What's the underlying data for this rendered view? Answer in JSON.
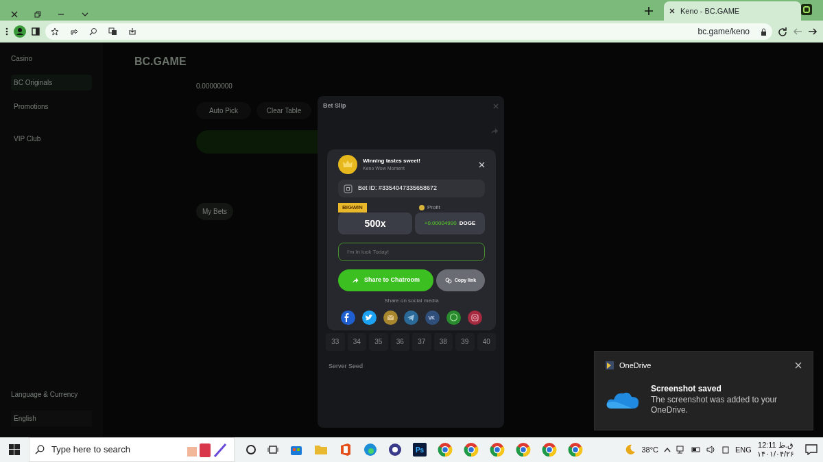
{
  "browser": {
    "tab_title": "Keno - BC.GAME",
    "url": "bc.game/keno"
  },
  "page": {
    "top_nav": "Casino",
    "logo": "BC.GAME",
    "sidebar": [
      {
        "label": "BC Originals",
        "selected": true
      },
      {
        "label": "Promotions",
        "selected": false
      },
      {
        "label": "VIP Club",
        "selected": false
      }
    ],
    "language_label": "Language & Currency",
    "language": "English",
    "bet_amount": "0.00000000",
    "buttons": [
      "Auto Pick",
      "Clear Table"
    ],
    "bet_tabs": [
      {
        "label": "My Bets",
        "selected": true
      }
    ]
  },
  "bet_slip": {
    "title": "Bet Slip",
    "numbers": [
      "33",
      "34",
      "35",
      "36",
      "37",
      "38",
      "39",
      "40"
    ],
    "section": "Server Seed"
  },
  "share": {
    "title": "Winning tastes sweet!",
    "subtitle": "Keno Wow Moment",
    "bet_id": "Bet ID: #3354047335658672",
    "badge": "BIGWIN",
    "multiplier": "500x",
    "profit_label": "Profit",
    "profit_amount": "+0.00004990",
    "currency": "DOGE",
    "message": "I'm in luck Today!",
    "share_button": "Share to Chatroom",
    "copy_button": "Copy link",
    "social_label": "Share on social media",
    "socials": [
      {
        "kind": "facebook",
        "color": "#1f5fd0"
      },
      {
        "kind": "twitter",
        "color": "#1da1f2"
      },
      {
        "kind": "email",
        "color": "#a8862e"
      },
      {
        "kind": "telegram",
        "color": "#2b6a98"
      },
      {
        "kind": "vk",
        "color": "#2f4e7a"
      },
      {
        "kind": "chat",
        "color": "#2a8a2e"
      },
      {
        "kind": "instagram",
        "color": "#a52a40"
      }
    ]
  },
  "notification": {
    "app": "OneDrive",
    "title": "Screenshot saved",
    "body": "The screenshot was added to your OneDrive."
  },
  "taskbar": {
    "search_placeholder": "Type here to search",
    "app_label": "Ps",
    "weather": "38°C",
    "language": "ENG",
    "time": "12:11 ق.ظ",
    "date": "۱۴۰۱/۰۴/۲۶"
  }
}
